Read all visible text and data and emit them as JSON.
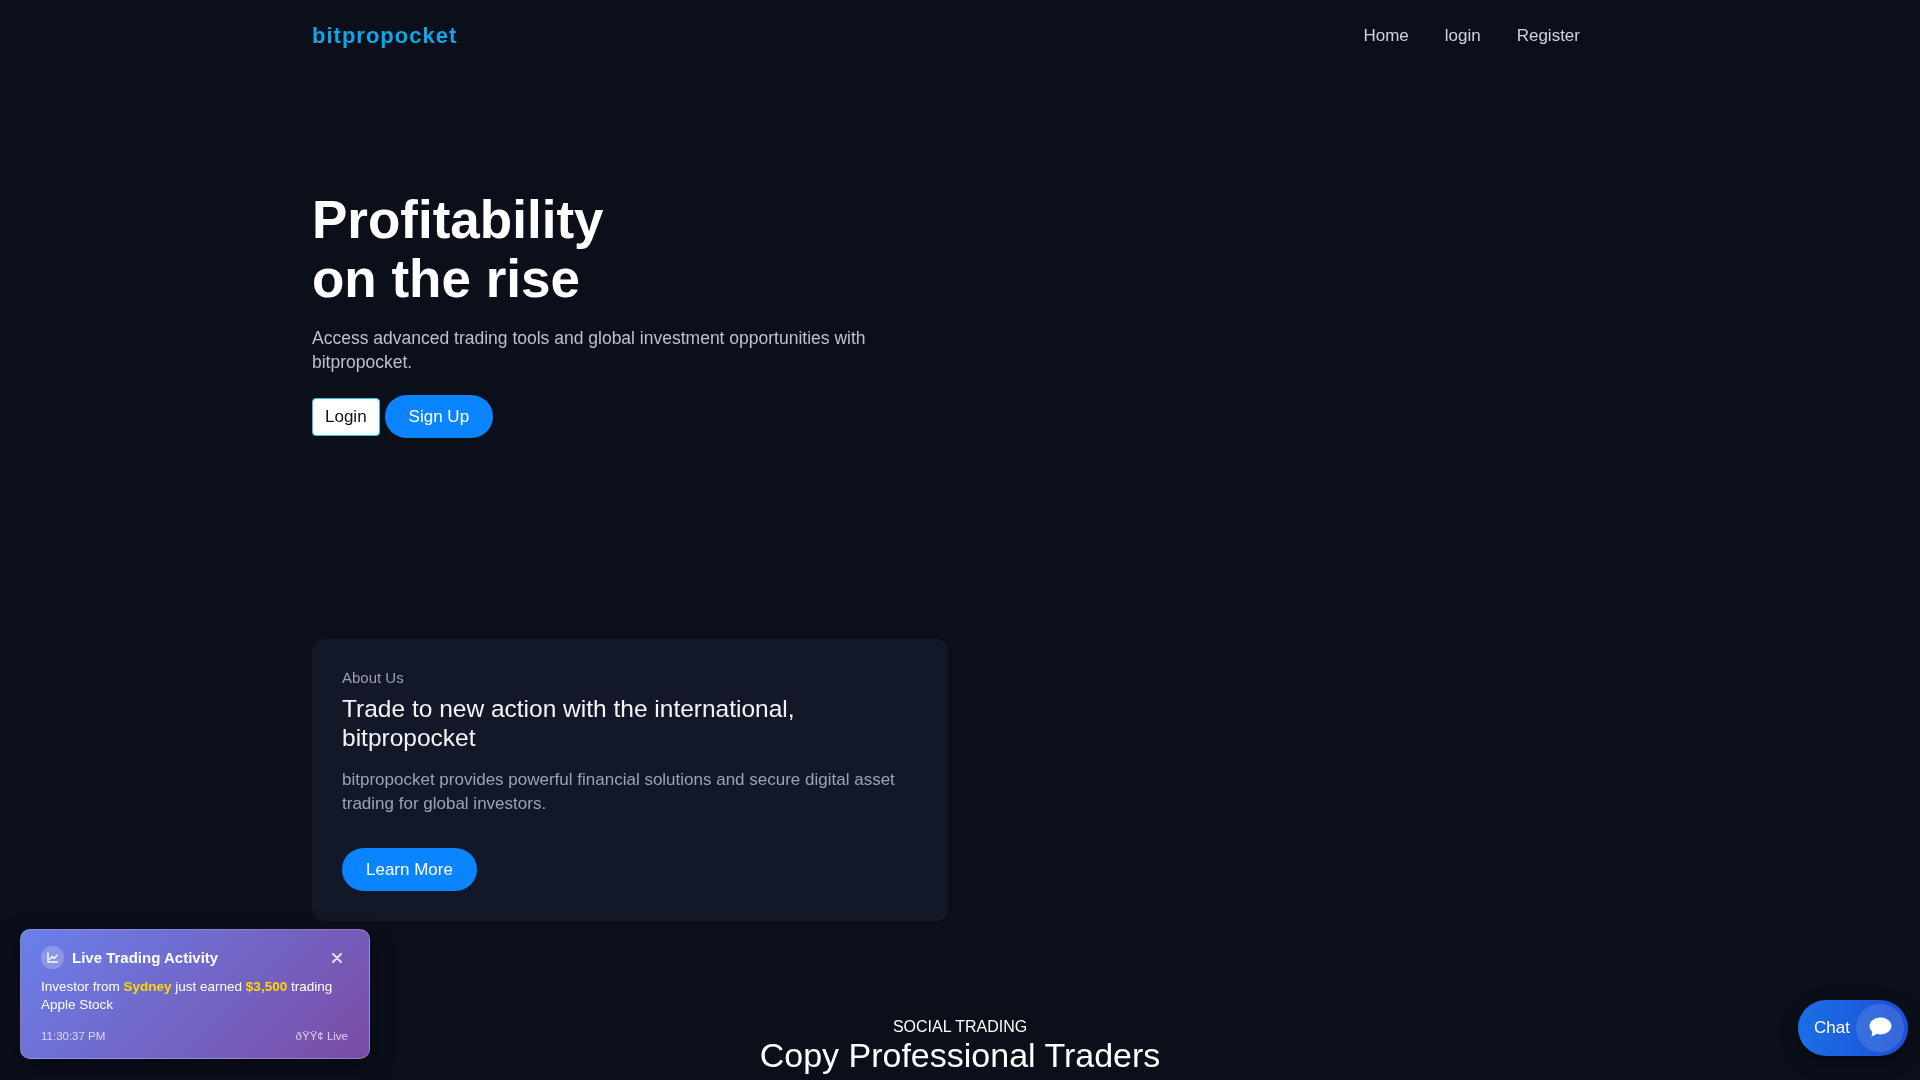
{
  "header": {
    "logo": "bitpropocket",
    "nav": [
      "Home",
      "login",
      "Register"
    ]
  },
  "hero": {
    "title": "Profitability on the rise",
    "subtitle": "Access advanced trading tools and global investment opportunities with bitpropocket.",
    "buttons": [
      {
        "label": "Login",
        "kind": "outline"
      },
      {
        "label": "Sign Up",
        "kind": "primary"
      }
    ]
  },
  "about": {
    "eyebrow": "About Us",
    "heading": "Trade to new action with the international, bitpropocket",
    "text": "bitpropocket provides powerful financial solutions and secure digital asset trading for global investors.",
    "button": "Learn More"
  },
  "social_trading": {
    "eyebrow": "SOCIAL TRADING",
    "heading": "Copy Professional Traders"
  },
  "activity_toast": {
    "title": "Live Trading Activity",
    "message": "Investor from **Sydney** just earned **$3,500** trading Apple Stock",
    "time": "11:30:37 PM",
    "status": "ðŸŸ¢ Live"
  },
  "chat": {
    "label": "Chat"
  }
}
